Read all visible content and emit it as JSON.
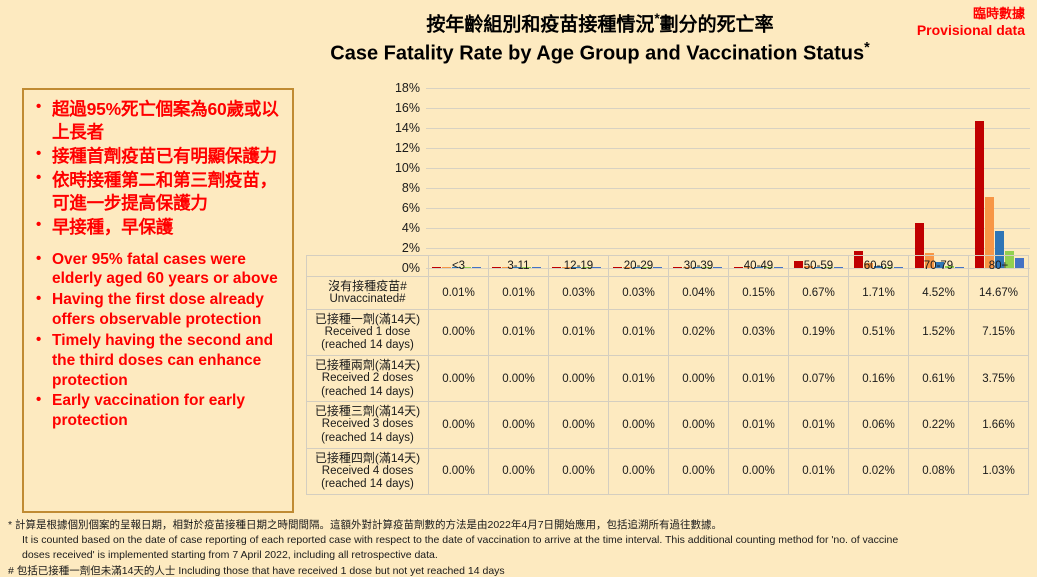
{
  "header": {
    "title_zh": "按年齡組別和疫苗接種情況",
    "title_zh_sup": "*",
    "title_zh_tail": "劃分的死亡率",
    "title_en": "Case Fatality Rate by Age Group and Vaccination Status",
    "title_en_sup": "*",
    "provisional_zh": "臨時數據",
    "provisional_en": "Provisional data",
    "provisional_color": "#FF0000"
  },
  "bullets": {
    "border_color": "#C08B33",
    "text_color": "#FF0000",
    "items_zh": [
      "超過95%死亡個案為60歲或以上長者",
      "接種首劑疫苗已有明顯保護力",
      "依時接種第二和第三劑疫苗，可進一步提高保護力",
      "早接種，早保護"
    ],
    "items_en": [
      "Over 95% fatal cases were elderly aged 60 years or above",
      "Having the first dose already offers observable protection",
      "Timely having the second and the third doses can enhance protection",
      "Early vaccination for early protection"
    ]
  },
  "chart_data": {
    "type": "bar",
    "title": "Case Fatality Rate by Age Group and Vaccination Status",
    "xlabel": "",
    "ylabel": "",
    "ylim": [
      0,
      18
    ],
    "ytick_labels": [
      "0%",
      "2%",
      "4%",
      "6%",
      "8%",
      "10%",
      "12%",
      "14%",
      "16%",
      "18%"
    ],
    "ytick_values": [
      0,
      2,
      4,
      6,
      8,
      10,
      12,
      14,
      16,
      18
    ],
    "grid": true,
    "legend_position": "none",
    "categories": [
      "<3",
      "3-11",
      "12-19",
      "20-29",
      "30-39",
      "40-49",
      "50-59",
      "60-69",
      "70-79",
      "80+"
    ],
    "series": [
      {
        "name": "沒有接種疫苗# Unvaccinated#",
        "color": "#C00000",
        "values": [
          0.01,
          0.01,
          0.03,
          0.03,
          0.04,
          0.15,
          0.67,
          1.71,
          4.52,
          14.67
        ]
      },
      {
        "name": "已接種一劑(滿14天) Received 1 dose (reached 14 days)",
        "color": "#F79646",
        "values": [
          0.0,
          0.01,
          0.01,
          0.01,
          0.02,
          0.03,
          0.19,
          0.51,
          1.52,
          7.15
        ]
      },
      {
        "name": "已接種兩劑(滿14天) Received 2 doses (reached 14 days)",
        "color": "#2E75B6",
        "values": [
          0.0,
          0.0,
          0.0,
          0.01,
          0.0,
          0.01,
          0.07,
          0.16,
          0.61,
          3.75
        ]
      },
      {
        "name": "已接種三劑(滿14天) Received 3 doses (reached 14 days)",
        "color": "#92D050",
        "values": [
          0.0,
          0.0,
          0.0,
          0.0,
          0.0,
          0.01,
          0.01,
          0.06,
          0.22,
          1.66
        ]
      },
      {
        "name": "已接種四劑(滿14天) Received 4 doses (reached 14 days)",
        "color": "#4472C4",
        "values": [
          0.0,
          0.0,
          0.0,
          0.0,
          0.0,
          0.0,
          0.01,
          0.02,
          0.08,
          1.03
        ]
      }
    ]
  },
  "table": {
    "columns": [
      "<3",
      "3-11",
      "12-19",
      "20-29",
      "30-39",
      "40-49",
      "50-59",
      "60-69",
      "70-79",
      "80+"
    ],
    "rows": [
      {
        "label_zh": "沒有接種疫苗#",
        "label_en": "Unvaccinated#",
        "label_en2": "",
        "values": [
          "0.01%",
          "0.01%",
          "0.03%",
          "0.03%",
          "0.04%",
          "0.15%",
          "0.67%",
          "1.71%",
          "4.52%",
          "14.67%"
        ]
      },
      {
        "label_zh": "已接種一劑(滿14天)",
        "label_en": "Received 1 dose",
        "label_en2": "(reached 14 days)",
        "values": [
          "0.00%",
          "0.01%",
          "0.01%",
          "0.01%",
          "0.02%",
          "0.03%",
          "0.19%",
          "0.51%",
          "1.52%",
          "7.15%"
        ]
      },
      {
        "label_zh": "已接種兩劑(滿14天)",
        "label_en": "Received 2 doses",
        "label_en2": "(reached 14 days)",
        "values": [
          "0.00%",
          "0.00%",
          "0.00%",
          "0.01%",
          "0.00%",
          "0.01%",
          "0.07%",
          "0.16%",
          "0.61%",
          "3.75%"
        ]
      },
      {
        "label_zh": "已接種三劑(滿14天)",
        "label_en": "Received 3 doses",
        "label_en2": "(reached 14 days)",
        "values": [
          "0.00%",
          "0.00%",
          "0.00%",
          "0.00%",
          "0.00%",
          "0.01%",
          "0.01%",
          "0.06%",
          "0.22%",
          "1.66%"
        ]
      },
      {
        "label_zh": "已接種四劑(滿14天)",
        "label_en": "Received 4 doses",
        "label_en2": "(reached 14 days)",
        "values": [
          "0.00%",
          "0.00%",
          "0.00%",
          "0.00%",
          "0.00%",
          "0.00%",
          "0.01%",
          "0.02%",
          "0.08%",
          "1.03%"
        ]
      }
    ]
  },
  "footnotes": {
    "line1": "* 計算是根據個別個案的呈報日期，相對於疫苗接種日期之時間間隔。這額外對計算疫苗劑數的方法是由2022年4月7日開始應用，包括追溯所有過往數據。",
    "line2": "It is counted based on the date of case reporting of each reported case with respect to the date of vaccination to arrive at the time interval. This additional counting method for 'no. of vaccine",
    "line3": "doses received' is implemented starting from 7 April 2022, including all retrospective data.",
    "line4": "# 包括已接種一劑但未滿14天的人士 Including those that have received 1 dose but not yet reached 14 days"
  }
}
